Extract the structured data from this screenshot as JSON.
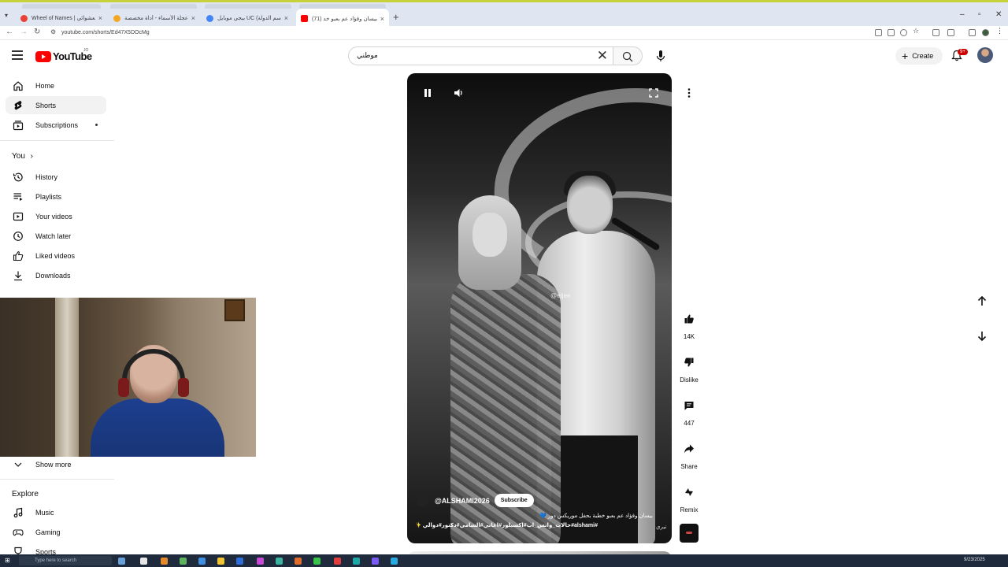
{
  "browser": {
    "tabs": [
      {
        "title": "Wheel of Names | علم العشوائي",
        "color": "#e94235",
        "active": false
      },
      {
        "title": "برنامج عجلة الأسماء - أداة مخصصة...",
        "color": "#f5a623",
        "active": false
      },
      {
        "title": "ببجي موبايل UC (اسم الدولة) | خد...",
        "color": "#4285f4",
        "active": false
      },
      {
        "title": "(71) بيسان وفؤاد عم بعبو خد...",
        "color": "#ff0000",
        "active": true
      }
    ],
    "url": "youtube.com/shorts/Ed47X5DOcMg"
  },
  "header": {
    "logo_text": "YouTube",
    "country_code": "JO",
    "search_value": "موطني",
    "create_label": "Create",
    "notif_count": "9+"
  },
  "sidebar": {
    "main": [
      {
        "label": "Home",
        "icon": "home-icon"
      },
      {
        "label": "Shorts",
        "icon": "shorts-icon",
        "active": true
      },
      {
        "label": "Subscriptions",
        "icon": "subscriptions-icon"
      }
    ],
    "you_title": "You",
    "you_items": [
      {
        "label": "History",
        "icon": "history-icon"
      },
      {
        "label": "Playlists",
        "icon": "playlists-icon"
      },
      {
        "label": "Your videos",
        "icon": "your-videos-icon"
      },
      {
        "label": "Watch later",
        "icon": "watch-later-icon"
      },
      {
        "label": "Liked videos",
        "icon": "like-icon"
      },
      {
        "label": "Downloads",
        "icon": "download-icon"
      }
    ],
    "show_more": "Show more",
    "explore_title": "Explore",
    "explore_items": [
      {
        "label": "Music",
        "icon": "music-icon"
      },
      {
        "label": "Gaming",
        "icon": "gaming-icon"
      },
      {
        "label": "Sports",
        "icon": "sports-icon"
      }
    ]
  },
  "video": {
    "watermark": "@etjee",
    "channel": "@ALSHAMI2026",
    "subscribe_label": "Subscribe",
    "title_line1": "بيسان وفؤاد عم بعبو خطبة بحفل موريكس دور 💙",
    "title_line2": "#alshami#حالات_واتس_اب#اكسبلور#اغاني#الشامي#دكتور#دوالي ✨",
    "signature": "نيري"
  },
  "actions": {
    "like_count": "14K",
    "dislike_label": "Dislike",
    "comments_count": "447",
    "share_label": "Share",
    "remix_label": "Remix"
  },
  "taskbar": {
    "search_placeholder": "Type here to search",
    "date": "9/23/2025"
  }
}
